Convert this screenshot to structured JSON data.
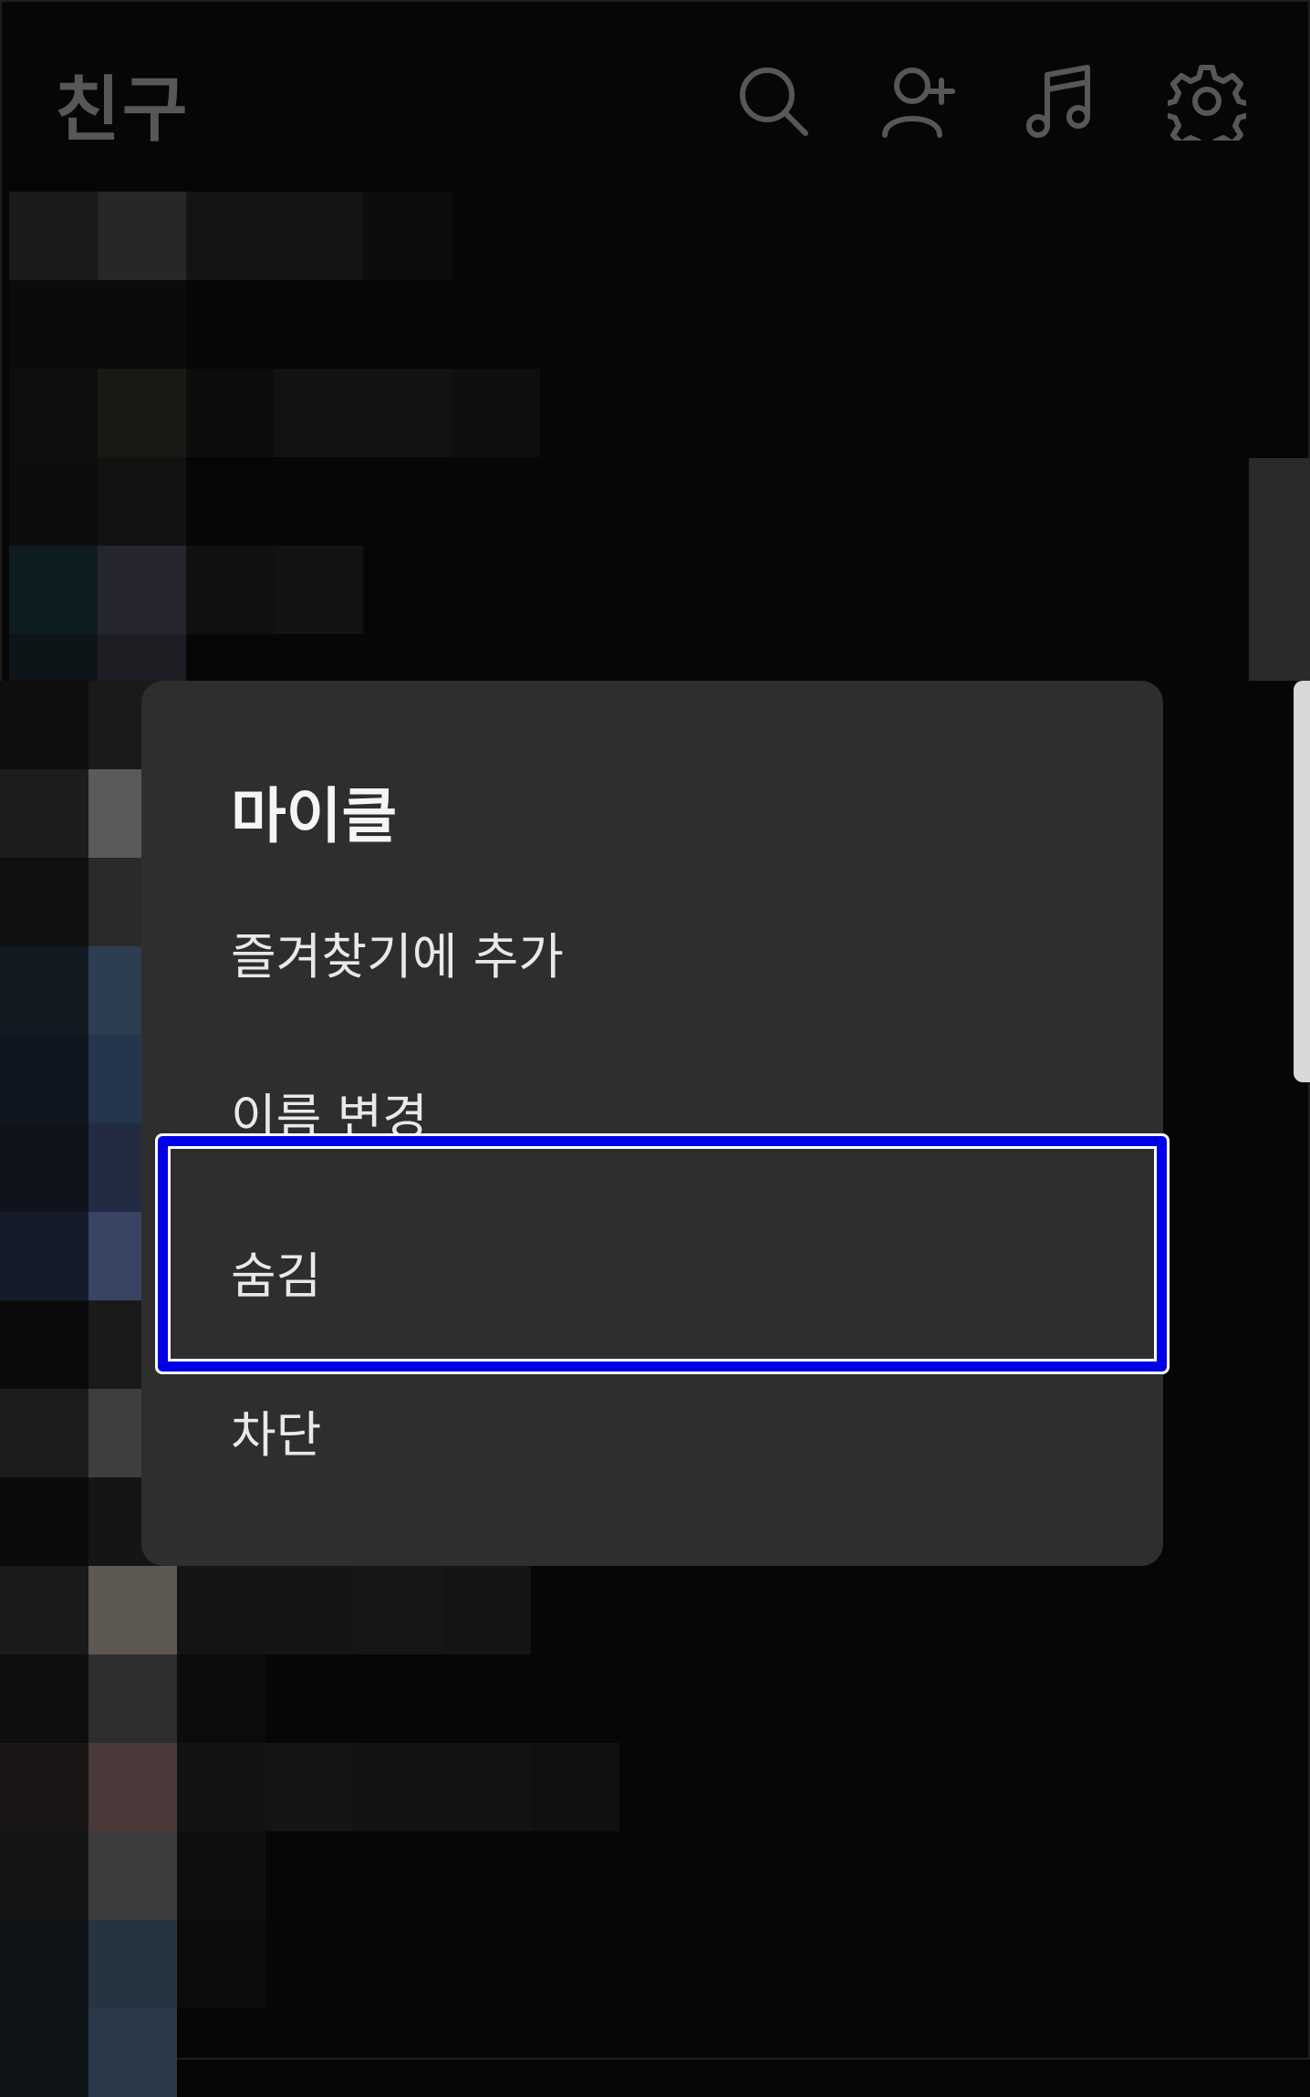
{
  "header": {
    "title": "친구",
    "icons": [
      "search-icon",
      "add-friend-icon",
      "music-icon",
      "settings-icon"
    ]
  },
  "menu": {
    "title": "마이클",
    "items": [
      {
        "label": "즐겨찾기에 추가"
      },
      {
        "label": "이름 변경"
      },
      {
        "label": "숨김",
        "highlighted": true
      },
      {
        "label": "차단"
      }
    ]
  },
  "colors": {
    "background": "#060606",
    "menu_background": "#2e2e2e",
    "header_icons": "#575757",
    "highlight_border": "#0000e6"
  }
}
